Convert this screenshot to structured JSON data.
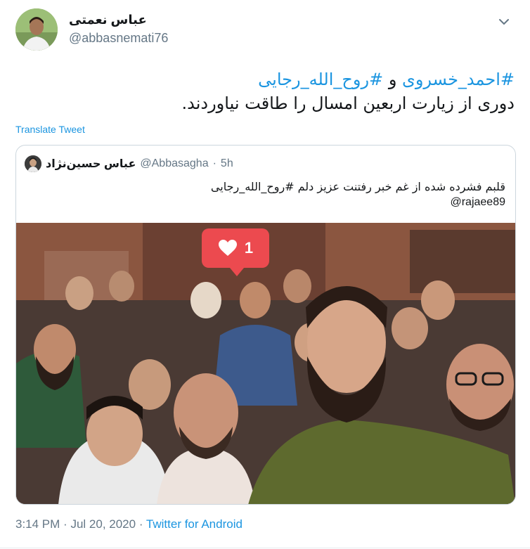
{
  "author": {
    "name": "عباس نعمتی",
    "handle": "@abbasnemati76"
  },
  "tweet": {
    "hashtag_1": "#احمد_خسروی",
    "conjunction": "و",
    "hashtag_2": "#روح_الله_رجایی",
    "text_line_2": "دوری از زیارت اربعین امسال را طاقت نیاوردند."
  },
  "translate_label": "Translate Tweet",
  "quoted": {
    "name": "عباس حسین‌نژاد",
    "handle": "@Abbasagha",
    "separator": "·",
    "time": "5h",
    "text": "قلبم فشرده شده از غم خبر رفتنت عزیز دلم #روح_الله_رجایی",
    "mention": "@rajaee89",
    "photo": {
      "description_icon": "photo-icon",
      "like_count": "1"
    }
  },
  "meta": {
    "time": "3:14 PM",
    "sep1": "·",
    "date": "Jul 20, 2020",
    "sep2": "·",
    "source": "Twitter for Android"
  },
  "colors": {
    "link": "#1b95e0",
    "secondary": "#657786",
    "border": "#ccd6dd",
    "like_badge": "#ec4a4f"
  },
  "icons": {
    "more": "chevron-down-icon",
    "heart": "heart-icon"
  }
}
